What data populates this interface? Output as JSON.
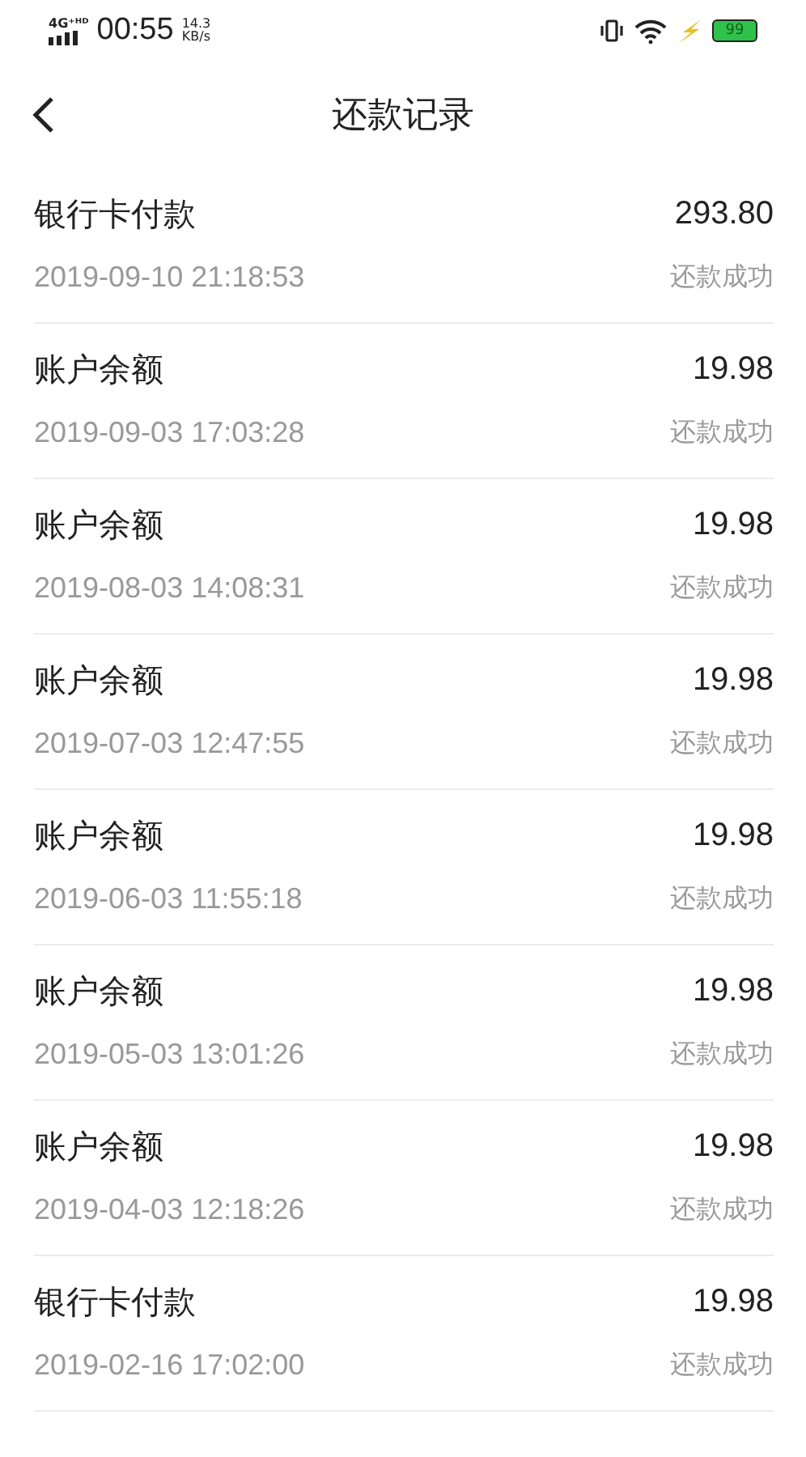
{
  "status_bar": {
    "network": "4G⁺ᴴᴰ",
    "time": "00:55",
    "speed_value": "14.3",
    "speed_unit": "KB/s",
    "battery": "99"
  },
  "nav": {
    "title": "还款记录"
  },
  "records": [
    {
      "method": "银行卡付款",
      "amount": "293.80",
      "datetime": "2019-09-10 21:18:53",
      "status": "还款成功"
    },
    {
      "method": "账户余额",
      "amount": "19.98",
      "datetime": "2019-09-03 17:03:28",
      "status": "还款成功"
    },
    {
      "method": "账户余额",
      "amount": "19.98",
      "datetime": "2019-08-03 14:08:31",
      "status": "还款成功"
    },
    {
      "method": "账户余额",
      "amount": "19.98",
      "datetime": "2019-07-03 12:47:55",
      "status": "还款成功"
    },
    {
      "method": "账户余额",
      "amount": "19.98",
      "datetime": "2019-06-03 11:55:18",
      "status": "还款成功"
    },
    {
      "method": "账户余额",
      "amount": "19.98",
      "datetime": "2019-05-03 13:01:26",
      "status": "还款成功"
    },
    {
      "method": "账户余额",
      "amount": "19.98",
      "datetime": "2019-04-03 12:18:26",
      "status": "还款成功"
    },
    {
      "method": "银行卡付款",
      "amount": "19.98",
      "datetime": "2019-02-16 17:02:00",
      "status": "还款成功"
    }
  ]
}
